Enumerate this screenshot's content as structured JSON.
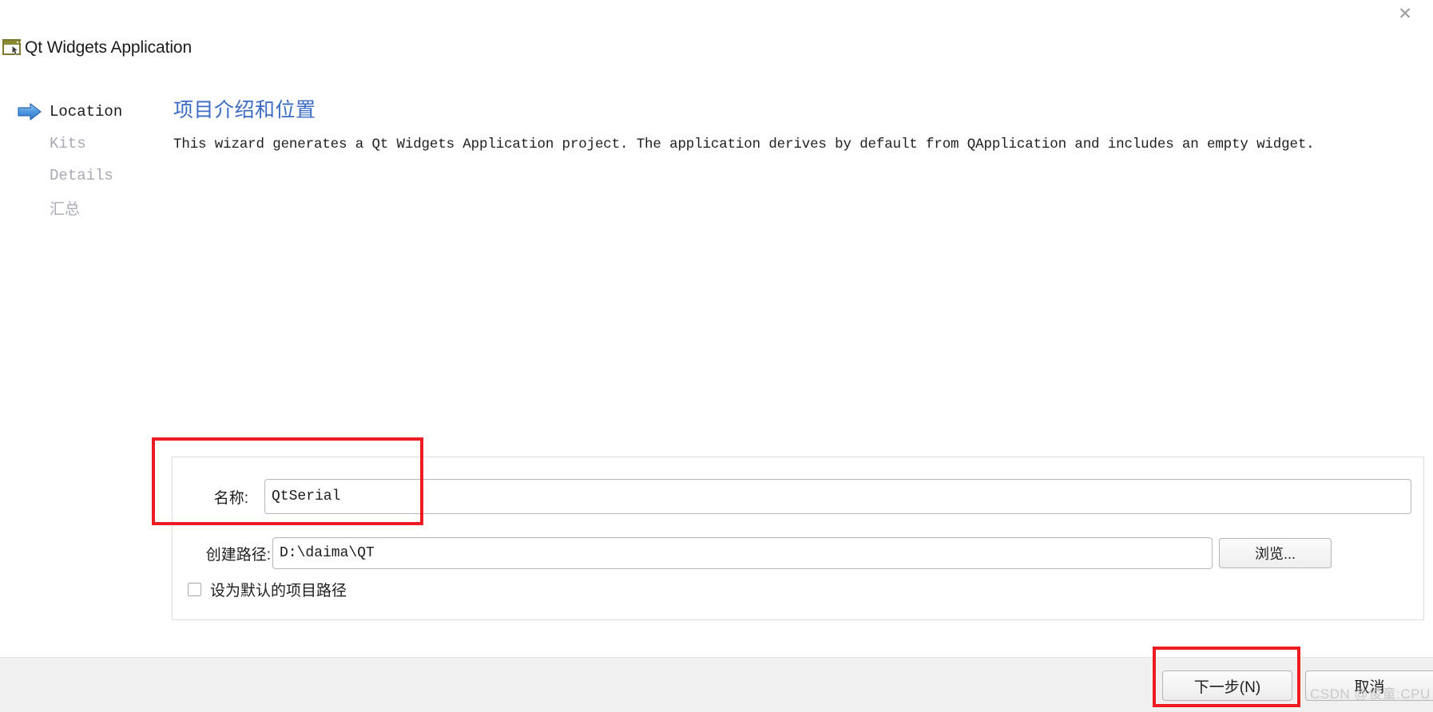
{
  "window": {
    "title": "Qt Widgets Application",
    "app_icon": "qt-window-icon",
    "close_label": "✕"
  },
  "sidebar": {
    "items": [
      {
        "label": "Location",
        "state": "active",
        "arrow_icon": "blue-arrow-icon"
      },
      {
        "label": "Kits",
        "state": "inactive"
      },
      {
        "label": "Details",
        "state": "inactive"
      },
      {
        "label": "汇总",
        "state": "inactive"
      }
    ]
  },
  "main": {
    "heading": "项目介绍和位置",
    "description": "This wizard generates a Qt Widgets Application project. The application derives by default from QApplication and includes an empty widget."
  },
  "form": {
    "name_label": "名称:",
    "name_value": "QtSerial",
    "name_placeholder": "",
    "path_label": "创建路径:",
    "path_value": "D:\\daima\\QT",
    "path_placeholder": "",
    "browse_label": "浏览...",
    "default_path_checkbox_label": "设为默认的项目路径",
    "default_path_checked": false
  },
  "footer": {
    "next_label": "下一步(N)",
    "cancel_label": "取消"
  },
  "annotations": {
    "color": "#ee1c20",
    "name_field_highlight": true,
    "next_button_highlight": true
  },
  "watermark": {
    "text": "CSDN @俊童:CPU"
  }
}
